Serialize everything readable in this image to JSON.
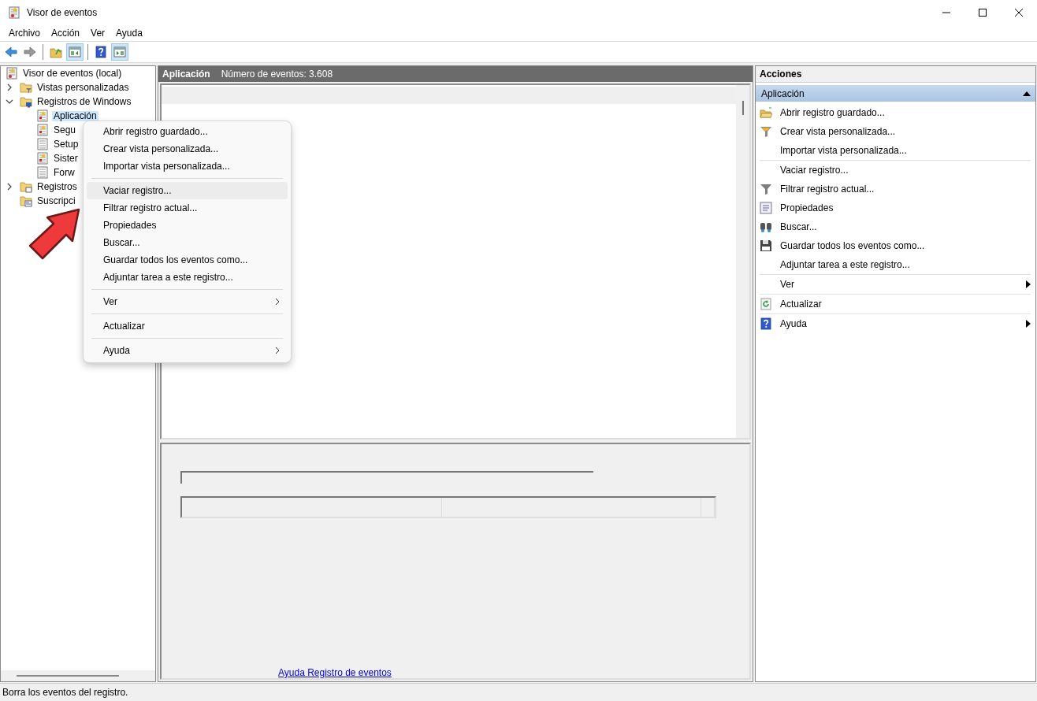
{
  "window": {
    "title": "Visor de eventos"
  },
  "menu_bar": [
    {
      "label": "Archivo"
    },
    {
      "label": "Acción"
    },
    {
      "label": "Ver"
    },
    {
      "label": "Ayuda"
    }
  ],
  "toolbar": [
    {
      "kind": "back",
      "pressed": false
    },
    {
      "kind": "forward",
      "pressed": false
    },
    {
      "kind": "folder-up",
      "pressed": false,
      "separator_before": true
    },
    {
      "kind": "tree-pane",
      "pressed": true
    },
    {
      "kind": "help",
      "pressed": false,
      "separator_before": true
    },
    {
      "kind": "action-pane",
      "pressed": true
    }
  ],
  "tree": {
    "label": "Visor de eventos (local)",
    "kind": "root",
    "selected": false,
    "children": [
      {
        "label": "Vistas personalizadas",
        "kind": "folder-filter",
        "expanded": false,
        "selected": false
      },
      {
        "label": "Registros de Windows",
        "kind": "folder-computer",
        "expanded": true,
        "selected": false,
        "children": [
          {
            "label": "Aplicación",
            "kind": "log-warning",
            "selected": true
          },
          {
            "label": "Segu",
            "kind": "log-warning",
            "selected": false
          },
          {
            "label": "Setup",
            "kind": "log",
            "selected": false
          },
          {
            "label": "Sister",
            "kind": "log-warning",
            "selected": false
          },
          {
            "label": "Forw",
            "kind": "log",
            "selected": false
          }
        ]
      },
      {
        "label": "Registros",
        "kind": "folder-window",
        "expanded": false,
        "selected": false
      },
      {
        "label": "Suscripci",
        "kind": "folder-subscription",
        "selected": false
      }
    ]
  },
  "center": {
    "header": {
      "title": "Aplicación",
      "event_count": "Número de eventos: 3.608"
    },
    "help_link": "Ayuda Registro de eventos"
  },
  "actions": {
    "title": "Acciones",
    "section": {
      "title": "Aplicación",
      "expanded": true
    },
    "items": [
      {
        "label": "Abrir registro guardado...",
        "kind": "open"
      },
      {
        "label": "Crear vista personalizada...",
        "kind": "create-view"
      },
      {
        "label": "Importar vista personalizada...",
        "kind": "none"
      },
      {
        "label": "Vaciar registro...",
        "kind": "none",
        "separator_before": true
      },
      {
        "label": "Filtrar registro actual...",
        "kind": "filter"
      },
      {
        "label": "Propiedades",
        "kind": "properties"
      },
      {
        "label": "Buscar...",
        "kind": "find"
      },
      {
        "label": "Guardar todos los eventos como...",
        "kind": "save"
      },
      {
        "label": "Adjuntar tarea a este registro...",
        "kind": "none"
      },
      {
        "label": "Ver",
        "kind": "none",
        "submenu": true,
        "separator_before": true
      },
      {
        "label": "Actualizar",
        "kind": "refresh",
        "separator_before": true
      },
      {
        "label": "Ayuda",
        "kind": "help",
        "submenu": true,
        "separator_before": true
      }
    ]
  },
  "context_menu": {
    "items": [
      {
        "label": "Abrir registro guardado...",
        "selected": false
      },
      {
        "label": "Crear vista personalizada...",
        "selected": false
      },
      {
        "label": "Importar vista personalizada...",
        "selected": false
      },
      {
        "label": "Vaciar registro...",
        "selected": true,
        "separator_before": true
      },
      {
        "label": "Filtrar registro actual...",
        "selected": false
      },
      {
        "label": "Propiedades",
        "selected": false
      },
      {
        "label": "Buscar...",
        "selected": false
      },
      {
        "label": "Guardar todos los eventos como...",
        "selected": false
      },
      {
        "label": "Adjuntar tarea a este registro...",
        "selected": false
      },
      {
        "label": "Ver",
        "selected": false,
        "submenu": true,
        "separator_before": true
      },
      {
        "label": "Actualizar",
        "selected": false,
        "separator_before": true
      },
      {
        "label": "Ayuda",
        "selected": false,
        "submenu": true,
        "separator_before": true
      }
    ]
  },
  "status_bar": {
    "text": "Borra los eventos del registro."
  }
}
